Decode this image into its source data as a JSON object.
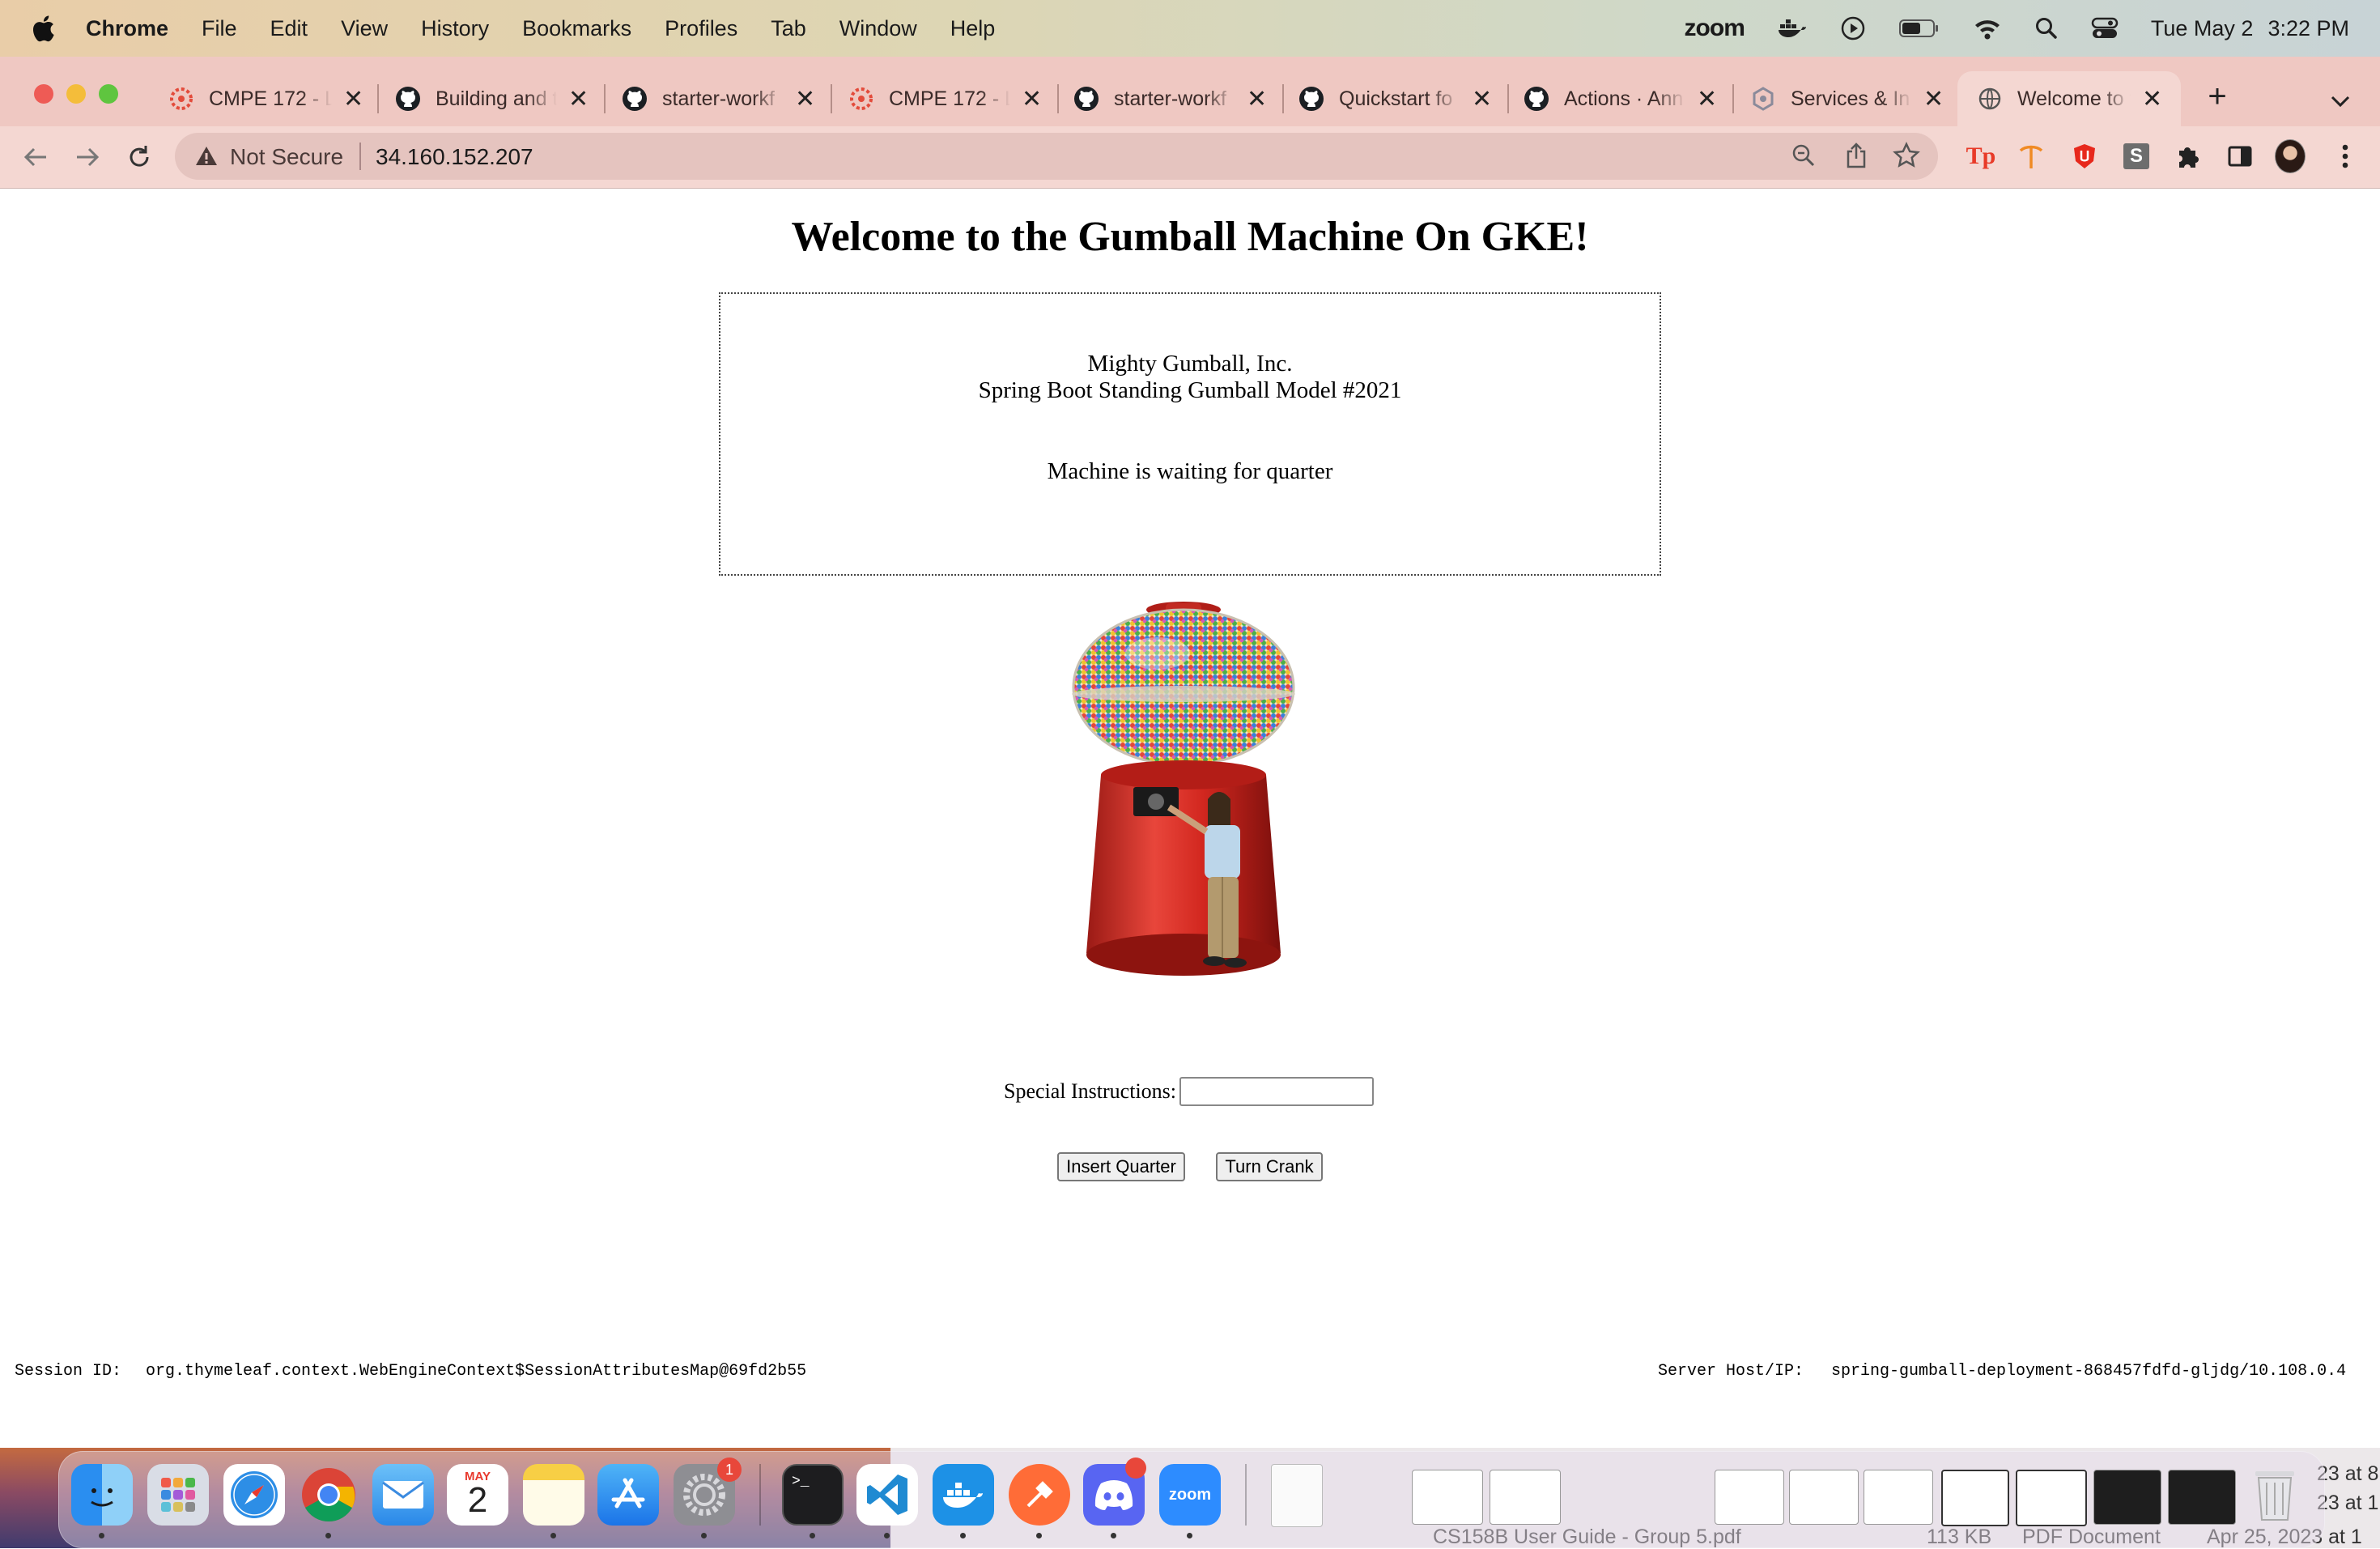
{
  "menubar": {
    "app_name": "Chrome",
    "items": [
      "File",
      "Edit",
      "View",
      "History",
      "Bookmarks",
      "Profiles",
      "Tab",
      "Window",
      "Help"
    ],
    "zoom_label": "zoom",
    "date": "Tue May 2",
    "time": "3:22 PM"
  },
  "tabs": [
    {
      "title": "CMPE 172 - L",
      "icon": "canvas-icon"
    },
    {
      "title": "Building and t",
      "icon": "github-icon"
    },
    {
      "title": "starter-workf",
      "icon": "github-icon"
    },
    {
      "title": "CMPE 172 - L",
      "icon": "canvas-icon"
    },
    {
      "title": "starter-workf",
      "icon": "github-icon"
    },
    {
      "title": "Quickstart fo",
      "icon": "github-icon"
    },
    {
      "title": "Actions · Ann",
      "icon": "github-icon"
    },
    {
      "title": "Services & In",
      "icon": "gcp-icon"
    },
    {
      "title": "Welcome to t",
      "icon": "globe-icon",
      "active": true
    }
  ],
  "address_bar": {
    "security_label": "Not Secure",
    "url": "34.160.152.207"
  },
  "page": {
    "title": "Welcome to the Gumball Machine On GKE!",
    "company": "Mighty Gumball, Inc.",
    "model": "Spring Boot Standing Gumball Model #2021",
    "state": "Machine is waiting for quarter",
    "instructions_label": "Special Instructions:",
    "instructions_value": "",
    "insert_quarter_label": "Insert Quarter",
    "turn_crank_label": "Turn Crank",
    "session_label": "Session ID:",
    "session_value": "org.thymeleaf.context.WebEngineContext$SessionAttributesMap@69fd2b55",
    "server_label": "Server Host/IP:",
    "server_value": "spring-gumball-deployment-868457fdfd-gljdg/10.108.0.4"
  },
  "dock": {
    "calendar_month": "MAY",
    "calendar_day": "2",
    "settings_badge": "1",
    "zoom_label": "zoom"
  },
  "background_window": {
    "filename": "CS158B User Guide - Group 5.pdf",
    "size": "113 KB",
    "kind": "PDF Document",
    "date": "Apr 25, 2023 at 1",
    "side_lines": [
      "23 at 8",
      "23 at 1",
      "23 at 1"
    ]
  },
  "colors": {
    "menubar": "#ddd6b4",
    "tabstrip": "#efc8c2",
    "toolbar": "#f4d7d2"
  }
}
